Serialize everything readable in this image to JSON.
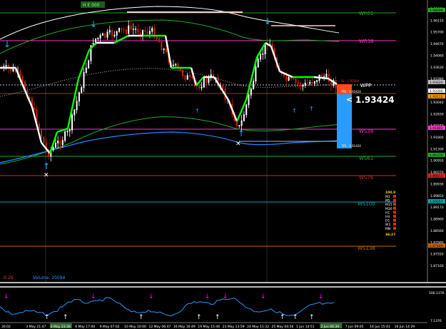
{
  "top_badge": "H E 000",
  "price_axis": {
    "ticks": [
      "1.98690",
      "1.96110",
      "1.95700",
      "1.94670",
      "1.94060",
      "1.93630",
      "1.93380",
      "1.93180",
      "1.93040",
      "1.92830",
      "1.92210",
      "1.91800",
      "1.91300",
      "1.90950",
      "1.90370",
      "1.89930",
      "1.89850",
      "1.89170",
      "1.88960",
      "1.88560",
      "1.87980",
      "1.87550",
      "1.87100"
    ],
    "highlight_tags": [
      {
        "text": "1.98694",
        "color": "#22aa22"
      },
      {
        "text": "1.93424",
        "color": "#c0c0c0"
      },
      {
        "text": "1.93304",
        "color": "#ffffff"
      },
      {
        "text": "1.93112",
        "color": "#ff9900"
      },
      {
        "text": "1.91881",
        "color": "#ff33cc"
      },
      {
        "text": "1.90376",
        "color": "#22aa22"
      },
      {
        "text": "1.89617",
        "color": "#dd2222"
      },
      {
        "text": "1.89267",
        "color": "#00aaaa"
      },
      {
        "text": "1.87489",
        "color": "#cc6600"
      }
    ]
  },
  "levels": [
    {
      "label": "WR61",
      "color": "#22aa22"
    },
    {
      "label": "WR38",
      "color": "#ff33cc"
    },
    {
      "label": "WPP",
      "color": "#ffffff"
    },
    {
      "label": "WS38",
      "color": "#ff33cc"
    },
    {
      "label": "WS61",
      "color": "#22aa22"
    },
    {
      "label": "WS76",
      "color": "#dd2222"
    },
    {
      "label": "WS100",
      "color": "#00aaaa"
    },
    {
      "label": "WS138",
      "color": "#cc6600"
    }
  ],
  "trade_tags": {
    "tp_upper": "TP2 : 1.93424",
    "tp_lower": "TP1 : 1.91424",
    "sl": "SL : 1.93504"
  },
  "current_price": "1.93424",
  "stats_panel": {
    "pct": "100.0",
    "tf": [
      "M1",
      "M5",
      "M15",
      "M30",
      "H1",
      "H4",
      "D1",
      "W1",
      "MN"
    ],
    "bottom": "36:27"
  },
  "indicator": {
    "value_left": "-0.29",
    "volume_label": "Volume: 20094",
    "scale_top": "100.1376",
    "scale_bottom": "7.1376"
  },
  "time_axis": {
    "labels": [
      "30.02",
      "3 May 21:47",
      "4 May 23:38",
      "6 May 17:00",
      "9 May 07:02",
      "10 May 10:00",
      "12 May 06:47",
      "16 May 16:49",
      "19 May 15:46",
      "23 May 13:59",
      "24 May 11:32",
      "25 May 04:56",
      "1 Jun 14:51",
      "2 Jun 06:39",
      "7 Jun 09:05",
      "14 Jun 15:43",
      "16 Jun 14:29"
    ]
  },
  "colors": {
    "bg": "#000000",
    "bull": "#ffffff",
    "bear": "#cc2200",
    "trend_up": "#00ff00",
    "trend_dn": "#ffffff",
    "blue": "#2288ff",
    "envelope_green": "#22aa22",
    "envelope_white": "#ffffff",
    "arrow": "#00bbff",
    "osc_line": "#2299ff",
    "osc_sell": "#ff00ff",
    "osc_buy": "#ffffff"
  }
}
